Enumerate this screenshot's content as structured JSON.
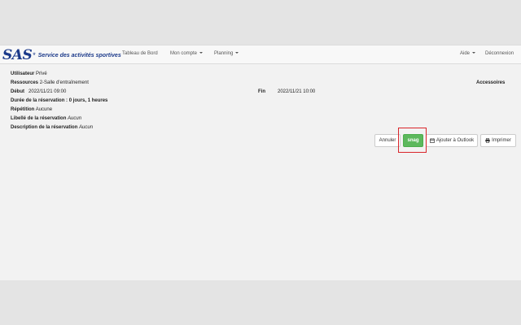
{
  "brand": {
    "mark": "SAS",
    "star": "*",
    "name": "Service des activités sportives"
  },
  "nav": {
    "dashboard": "Tableau de Bord",
    "account": "Mon compte",
    "planning": "Planning",
    "help": "Aide",
    "logout": "Déconnexion"
  },
  "details": {
    "user_label": "Utilisateur",
    "user_value": "Privé",
    "resources_label": "Ressources",
    "resources_value": "2-Salle d'entraînement",
    "accessories_label": "Accessoires",
    "start_label": "Début",
    "start_value": "2022/11/21 09:00",
    "end_label": "Fin",
    "end_value": "2022/11/21 10:00",
    "duration_label": "Durée de la réservation :",
    "duration_value": "0 jours, 1 heures",
    "repeat_label": "Répétition",
    "repeat_value": "Aucune",
    "title_label": "Libellé de la réservation",
    "title_value": "Aucun",
    "description_label": "Description de la réservation",
    "description_value": "Aucun"
  },
  "actions": {
    "cancel": "Annuler",
    "snag": "snag",
    "outlook": "Ajouter à Outlook",
    "print": "Imprimer"
  },
  "colors": {
    "accent_green": "#5cb85c",
    "brand_blue": "#1c3a8a",
    "highlight_red": "#d9252a"
  }
}
